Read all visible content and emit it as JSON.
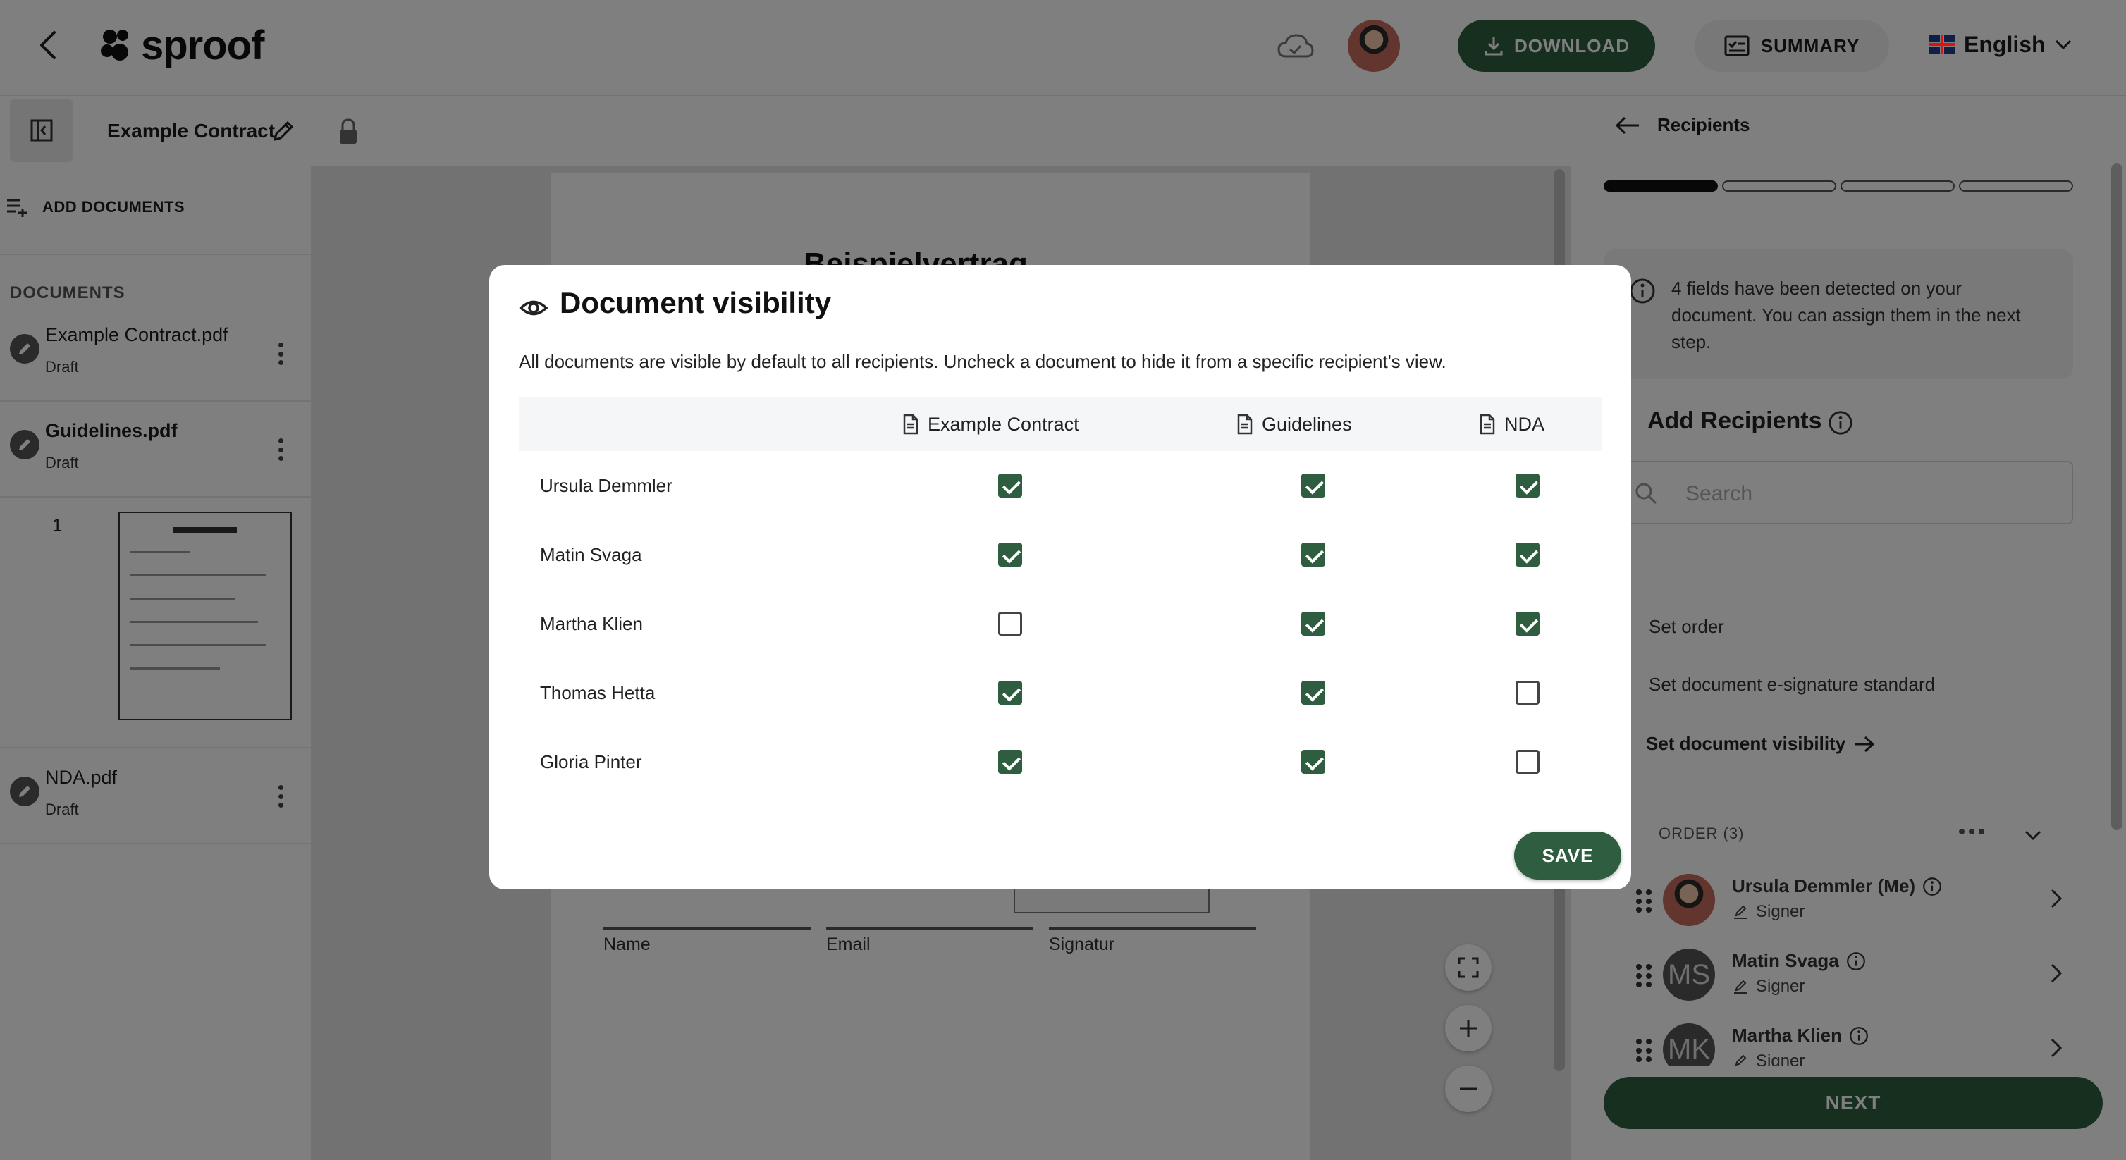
{
  "header": {
    "logo_text": "sproof",
    "download_label": "DOWNLOAD",
    "summary_label": "SUMMARY",
    "language": "English"
  },
  "subbar": {
    "document_title": "Example Contract"
  },
  "sidebar": {
    "add_documents_label": "ADD DOCUMENTS",
    "documents_heading": "DOCUMENTS",
    "documents": [
      {
        "name": "Example Contract.pdf",
        "status": "Draft"
      },
      {
        "name": "Guidelines.pdf",
        "status": "Draft"
      },
      {
        "name": "NDA.pdf",
        "status": "Draft"
      }
    ],
    "page_number": "1"
  },
  "viewer": {
    "page_heading": "Beispielvertrag",
    "signature_labels": [
      "Name",
      "Email",
      "Signatur"
    ]
  },
  "right_panel": {
    "title": "Recipients",
    "progress_steps_done": 1,
    "progress_steps_total": 4,
    "info_text": "4 fields have been detected on your document. You can assign them in the next step.",
    "add_recipients_heading": "Add Recipients",
    "search_placeholder": "Search",
    "set_order": "Set order",
    "set_standard": "Set document e-signature standard",
    "set_visibility": "Set document visibility",
    "order_label": "ORDER (3)",
    "recipients": [
      {
        "name": "Ursula Demmler (Me)",
        "role": "Signer",
        "initials": ""
      },
      {
        "name": "Matin Svaga",
        "role": "Signer",
        "initials": "MS"
      },
      {
        "name": "Martha Klien",
        "role": "Signer",
        "initials": "MK"
      }
    ],
    "next_label": "NEXT"
  },
  "modal": {
    "title": "Document visibility",
    "description": "All documents are visible by default to all recipients. Uncheck a document to hide it from a specific recipient's view.",
    "columns": [
      "Example Contract",
      "Guidelines",
      "NDA"
    ],
    "rows": [
      {
        "name": "Ursula Demmler",
        "visible": [
          true,
          true,
          true
        ]
      },
      {
        "name": "Matin Svaga",
        "visible": [
          true,
          true,
          true
        ]
      },
      {
        "name": "Martha Klien",
        "visible": [
          false,
          true,
          true
        ]
      },
      {
        "name": "Thomas Hetta",
        "visible": [
          true,
          true,
          false
        ]
      },
      {
        "name": "Gloria Pinter",
        "visible": [
          true,
          true,
          false
        ]
      }
    ],
    "save_label": "SAVE"
  },
  "colors": {
    "primary_green": "#2e5e3f",
    "overlay": "rgba(0,0,0,0.5)"
  }
}
